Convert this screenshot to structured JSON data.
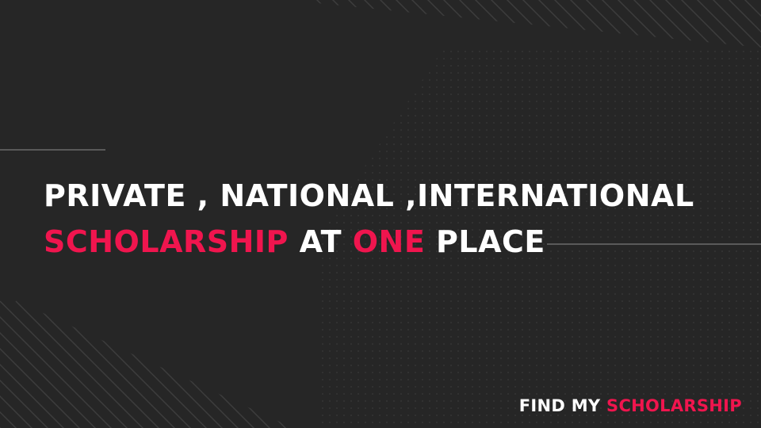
{
  "headline": {
    "line1": "PRIVATE , NATIONAL ,INTERNATIONAL",
    "line2_part1": "SCHOLARSHIP",
    "line2_part2": " AT ",
    "line2_part3": "ONE",
    "line2_part4": " PLACE"
  },
  "brand": {
    "part1": "FIND MY ",
    "part2": "SCHOLARSHIP"
  },
  "colors": {
    "background": "#262626",
    "text": "#ffffff",
    "accent": "#f0154e",
    "decoration": "#555555"
  }
}
